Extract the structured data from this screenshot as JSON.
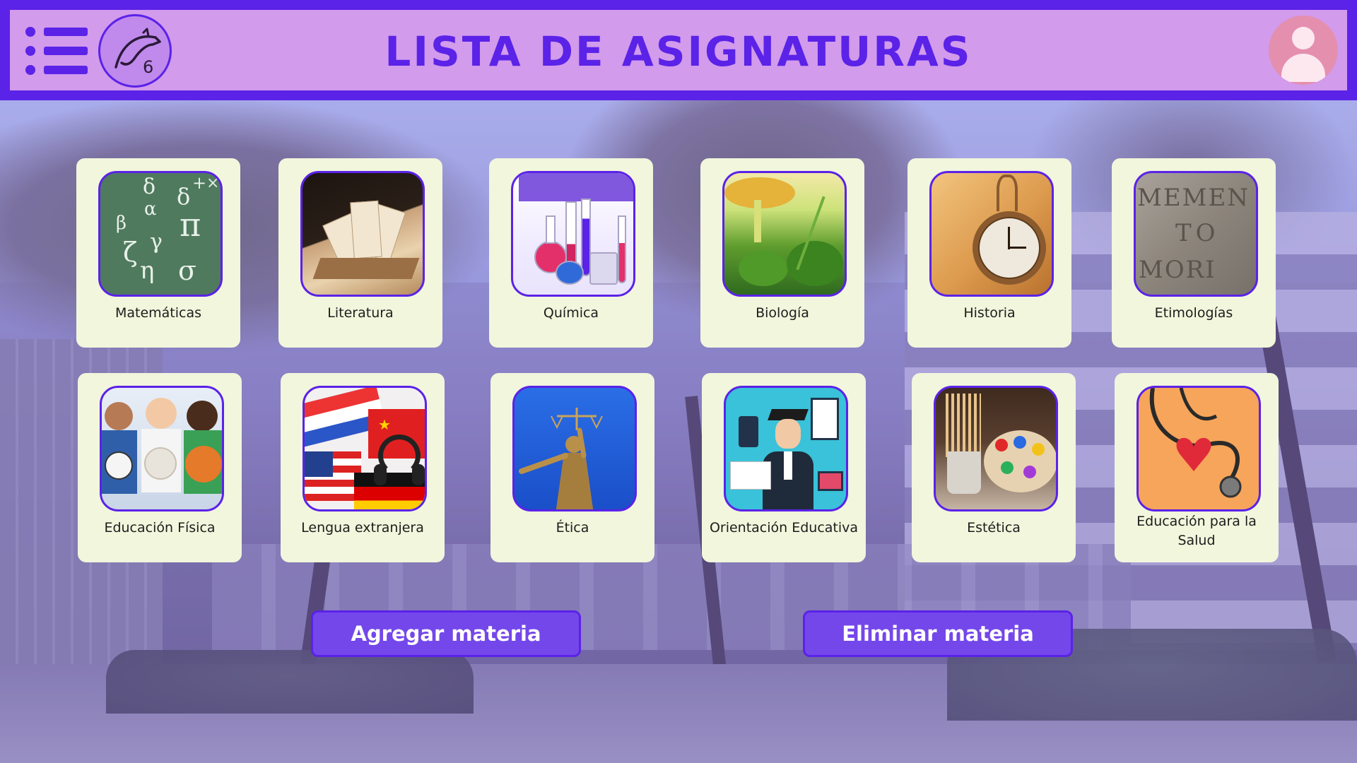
{
  "header": {
    "title": "LISTA DE ASIGNATURAS",
    "logo_text": "6",
    "colors": {
      "frame": "#5b22e8",
      "bar": "#d29bec",
      "avatar": "#e58faf"
    }
  },
  "subjects": [
    {
      "label": "Matemáticas",
      "icon": "math-chalkboard-image"
    },
    {
      "label": "Literatura",
      "icon": "open-book-image"
    },
    {
      "label": "Química",
      "icon": "lab-flasks-image"
    },
    {
      "label": "Biología",
      "icon": "mushroom-plant-image"
    },
    {
      "label": "Historia",
      "icon": "pocket-watch-image"
    },
    {
      "label": "Etimologías",
      "icon": "stone-inscription-image"
    },
    {
      "label": "Educación Física",
      "icon": "kids-with-balls-image"
    },
    {
      "label": "Lengua extranjera",
      "icon": "flags-headphones-image"
    },
    {
      "label": "Ética",
      "icon": "justice-statue-image"
    },
    {
      "label": "Orientación Educativa",
      "icon": "graduate-illustration-image"
    },
    {
      "label": "Estética",
      "icon": "paint-palette-image"
    },
    {
      "label": "Educación para la Salud",
      "icon": "stethoscope-heart-image"
    }
  ],
  "actions": {
    "add_label": "Agregar materia",
    "remove_label": "Eliminar materia"
  },
  "math_symbols": [
    "π",
    "α",
    "β",
    "γ",
    "σ",
    "δ",
    "ζ",
    "η",
    "+",
    "−",
    "×"
  ],
  "colors": {
    "card_bg": "#f1f6dc",
    "button_bg": "#7447ea",
    "accent": "#5b22e8"
  }
}
